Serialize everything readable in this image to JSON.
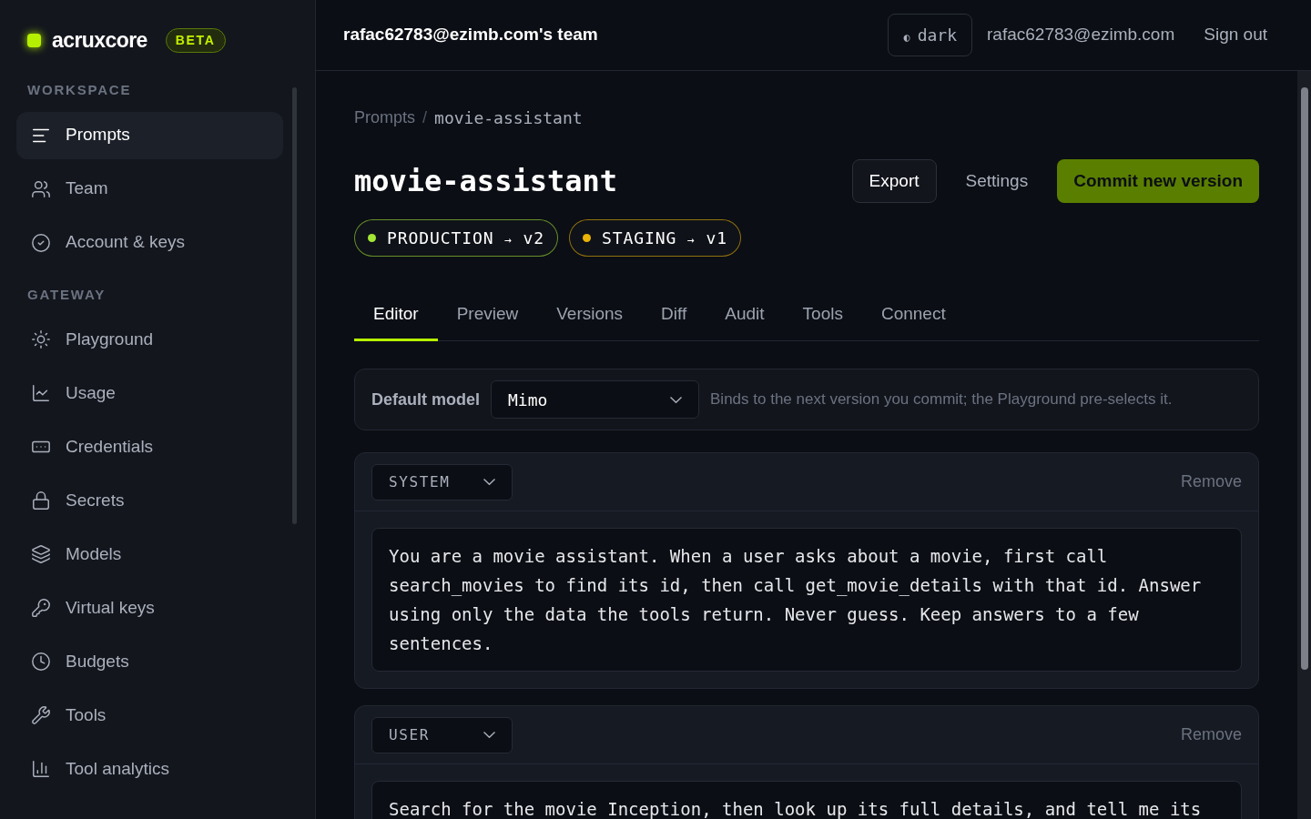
{
  "brand": {
    "name": "acruxcore",
    "badge": "BETA"
  },
  "sidebar": {
    "sections": [
      {
        "title": "WORKSPACE",
        "items": [
          {
            "label": "Prompts",
            "kind": "lines",
            "selected": true
          },
          {
            "label": "Team",
            "kind": "users",
            "selected": false
          },
          {
            "label": "Account & keys",
            "kind": "check",
            "selected": false
          }
        ]
      },
      {
        "title": "GATEWAY",
        "items": [
          {
            "label": "Playground",
            "kind": "sun",
            "selected": false
          },
          {
            "label": "Usage",
            "kind": "chart",
            "selected": false
          },
          {
            "label": "Credentials",
            "kind": "card",
            "selected": false
          },
          {
            "label": "Secrets",
            "kind": "lock",
            "selected": false
          },
          {
            "label": "Models",
            "kind": "layers",
            "selected": false
          },
          {
            "label": "Virtual keys",
            "kind": "key",
            "selected": false
          },
          {
            "label": "Budgets",
            "kind": "clock",
            "selected": false
          },
          {
            "label": "Tools",
            "kind": "wrench",
            "selected": false
          },
          {
            "label": "Tool analytics",
            "kind": "bars",
            "selected": false
          }
        ]
      }
    ]
  },
  "header": {
    "team": "rafac62783@ezimb.com's team",
    "theme_toggle": {
      "icon": "◐",
      "label": "dark"
    },
    "email": "rafac62783@ezimb.com",
    "sign_out": "Sign out"
  },
  "breadcrumb": [
    "Prompts",
    "/",
    "movie-assistant"
  ],
  "title": "movie-assistant",
  "actions": [
    {
      "label": "Export",
      "kind": "outline"
    },
    {
      "label": "Settings",
      "kind": "ghost"
    },
    {
      "label": "Commit new version",
      "kind": "primary"
    }
  ],
  "environments": [
    {
      "name": "PRODUCTION",
      "arrow": "→",
      "version": "v2",
      "color": "#a3e635"
    },
    {
      "name": "STAGING",
      "arrow": "→",
      "version": "v1",
      "color": "#eab308"
    }
  ],
  "tabs": [
    {
      "label": "Editor",
      "selected": true
    },
    {
      "label": "Preview",
      "selected": false
    },
    {
      "label": "Versions",
      "selected": false
    },
    {
      "label": "Diff",
      "selected": false
    },
    {
      "label": "Audit",
      "selected": false
    },
    {
      "label": "Tools",
      "selected": false
    },
    {
      "label": "Connect",
      "selected": false
    }
  ],
  "default_model": {
    "label": "Default model",
    "value": "Mimo",
    "hint": "Binds to the next version you commit; the Playground pre-selects it."
  },
  "messages": [
    {
      "role": "SYSTEM",
      "remove": "Remove",
      "content": "You are a movie assistant. When a user asks about a movie, first call search_movies to find its id, then call get_movie_details with that id. Answer using only the data the tools return. Never guess. Keep answers to a few sentences."
    },
    {
      "role": "USER",
      "remove": "Remove",
      "content": "Search for the movie Inception, then look up its full details, and tell me its"
    }
  ]
}
